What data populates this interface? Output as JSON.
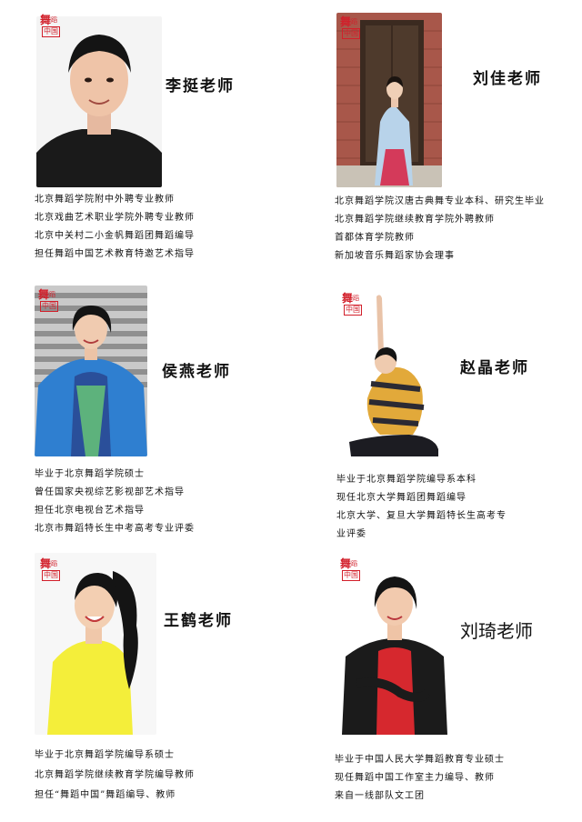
{
  "logo": {
    "top": "舞",
    "top_small": "蹈",
    "bottom": "中国"
  },
  "teachers": [
    {
      "name": "李挺老师",
      "lines": [
        "北京舞蹈学院附中外聘专业教师",
        "北京戏曲艺术职业学院外聘专业教师",
        "北京中关村二小金帆舞蹈团舞蹈编导",
        "担任舞蹈中国艺术教育特邀艺术指导"
      ]
    },
    {
      "name": "刘佳老师",
      "lines": [
        "北京舞蹈学院汉唐古典舞专业本科、研究生毕业",
        "北京舞蹈学院继续教育学院外聘教师",
        "首都体育学院教师",
        "新加坡音乐舞蹈家协会理事"
      ]
    },
    {
      "name": "侯燕老师",
      "lines": [
        "毕业于北京舞蹈学院硕士",
        "曾任国家央视综艺影视部艺术指导",
        "担任北京电视台艺术指导",
        "北京市舞蹈特长生中考高考专业评委"
      ]
    },
    {
      "name": "赵晶老师",
      "lines": [
        "毕业于北京舞蹈学院编导系本科",
        "现任北京大学舞蹈团舞蹈编导",
        "北京大学、复旦大学舞蹈特长生高考专",
        "业评委"
      ]
    },
    {
      "name": "王鹤老师",
      "lines": [
        "毕业于北京舞蹈学院编导系硕士",
        "北京舞蹈学院继续教育学院编导教师",
        "担任“舞蹈中国”舞蹈编导、教师"
      ]
    },
    {
      "name": "刘琦老师",
      "lines": [
        "毕业于中国人民大学舞蹈教育专业硕士",
        "现任舞蹈中国工作室主力编导、教师",
        "来自一线部队文工团"
      ]
    }
  ],
  "colors": {
    "brand_red": "#d21f2a",
    "text": "#111111"
  }
}
